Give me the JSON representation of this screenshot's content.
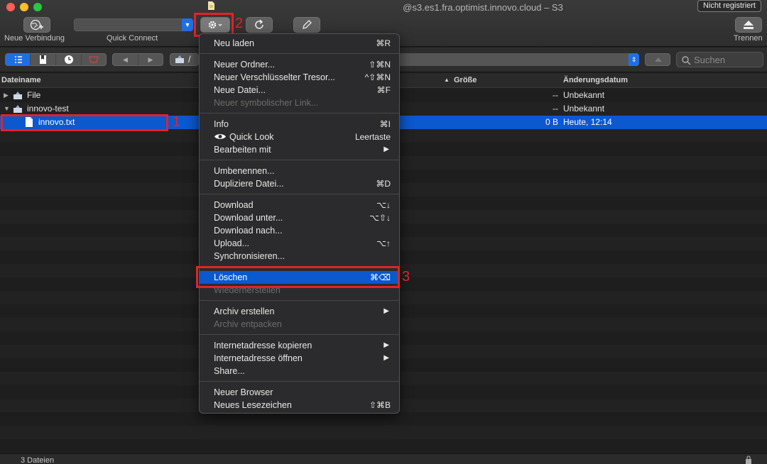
{
  "window": {
    "title": "@s3.es1.fra.optimist.innovo.cloud – S3",
    "register_label": "Nicht registriert"
  },
  "toolbar": {
    "new_connection_label": "Neue Verbindung",
    "quick_connect_label": "Quick Connect",
    "disconnect_label": "Trennen"
  },
  "nav": {
    "path_label": "/",
    "search_placeholder": "Suchen"
  },
  "columns": {
    "filename": "Dateiname",
    "size": "Größe",
    "modified": "Änderungsdatum"
  },
  "files": [
    {
      "name": "File",
      "size": "--",
      "date": "Unbekannt"
    },
    {
      "name": "innovo-test",
      "size": "--",
      "date": "Unbekannt"
    },
    {
      "name": "innovo.txt",
      "size": "0 B",
      "date": "Heute, 12:14"
    }
  ],
  "annotations": {
    "n1": "1",
    "n2": "2",
    "n3": "3"
  },
  "status": {
    "count_text": "3 Dateien"
  },
  "menu": {
    "refresh": {
      "label": "Neu laden",
      "shortcut": "⌘R"
    },
    "new_folder": {
      "label": "Neuer Ordner...",
      "shortcut": "⇧⌘N"
    },
    "new_vault": {
      "label": "Neuer Verschlüsselter Tresor...",
      "shortcut": "^⇧⌘N"
    },
    "new_file": {
      "label": "Neue Datei...",
      "shortcut": "⌘F"
    },
    "new_symlink": {
      "label": "Neuer symbolischer Link..."
    },
    "info": {
      "label": "Info",
      "shortcut": "⌘I"
    },
    "quicklook": {
      "label": "Quick Look",
      "shortcut": "Leertaste"
    },
    "edit_with": {
      "label": "Bearbeiten mit"
    },
    "rename": {
      "label": "Umbenennen..."
    },
    "duplicate": {
      "label": "Dupliziere Datei...",
      "shortcut": "⌘D"
    },
    "download": {
      "label": "Download",
      "shortcut": "⌥↓"
    },
    "download_as": {
      "label": "Download unter...",
      "shortcut": "⌥⇧↓"
    },
    "download_to": {
      "label": "Download nach..."
    },
    "upload": {
      "label": "Upload...",
      "shortcut": "⌥↑"
    },
    "sync": {
      "label": "Synchronisieren..."
    },
    "delete": {
      "label": "Löschen",
      "shortcut": "⌘⌫"
    },
    "restore": {
      "label": "Wiederherstellen"
    },
    "archive_create": {
      "label": "Archiv erstellen"
    },
    "archive_extract": {
      "label": "Archiv entpacken"
    },
    "copy_url": {
      "label": "Internetadresse kopieren"
    },
    "open_url": {
      "label": "Internetadresse öffnen"
    },
    "share": {
      "label": "Share..."
    },
    "new_browser": {
      "label": "Neuer Browser"
    },
    "new_bookmark": {
      "label": "Neues Lesezeichen",
      "shortcut": "⇧⌘B"
    }
  }
}
